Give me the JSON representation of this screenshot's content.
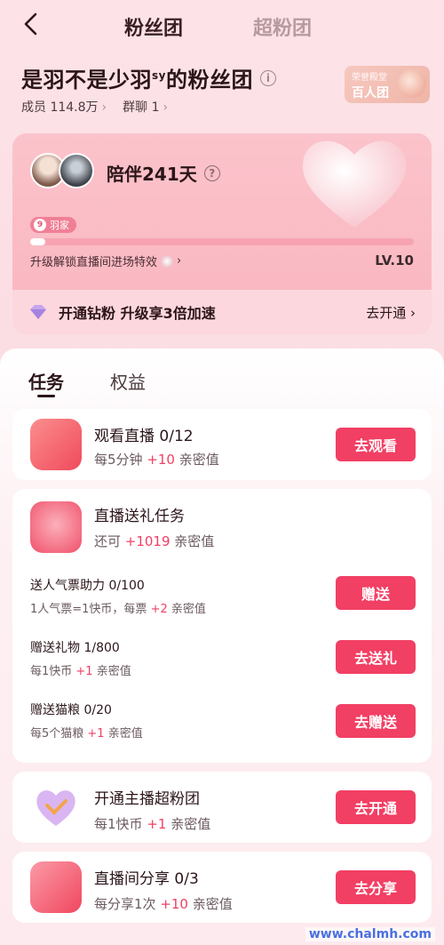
{
  "nav": {
    "tab_fans": "粉丝团",
    "tab_super": "超粉团"
  },
  "header": {
    "title": "是羽不是少羽",
    "title_sup": "sy",
    "title_suffix": "的粉丝团",
    "members": "成员 114.8万",
    "group_chat": "群聊 1"
  },
  "honor": {
    "line1": "荣誉殿堂",
    "line2": "百人团"
  },
  "card": {
    "accompany": "陪伴241天",
    "badge_level": "9",
    "badge_name": "羽家",
    "progress_fraction": 0.04,
    "unlock_text": "升级解锁直播间进场特效",
    "level": "LV.10",
    "diamond_text": "开通钻粉 升级享3倍加速",
    "diamond_action": "去开通"
  },
  "tabs": {
    "task": "任务",
    "rights": "权益"
  },
  "tasks": {
    "watch": {
      "title": "观看直播 0/12",
      "sub_pre": "每5分钟 ",
      "sub_val": "+10",
      "sub_post": " 亲密值",
      "button": "去观看"
    },
    "gift": {
      "title": "直播送礼任务",
      "sub_pre": "还可 ",
      "sub_val": "+1019",
      "sub_post": " 亲密值"
    },
    "popularity": {
      "title": "送人气票助力 0/100",
      "sub_pre": "1人气票=1快币，每票 ",
      "sub_val": "+2",
      "sub_post": " 亲密值",
      "button": "赠送"
    },
    "present": {
      "title": "赠送礼物 1/800",
      "sub_pre": "每1快币 ",
      "sub_val": "+1",
      "sub_post": " 亲密值",
      "button": "去送礼"
    },
    "catfood": {
      "title": "赠送猫粮 0/20",
      "sub_pre": "每5个猫粮 ",
      "sub_val": "+1",
      "sub_post": " 亲密值",
      "button": "去赠送"
    },
    "superfan": {
      "title": "开通主播超粉团",
      "sub_pre": "每1快币 ",
      "sub_val": "+1",
      "sub_post": " 亲密值",
      "button": "去开通"
    },
    "share": {
      "title": "直播间分享 0/3",
      "sub_pre": "每分享1次 ",
      "sub_val": "+10",
      "sub_post": " 亲密值",
      "button": "去分享"
    }
  },
  "watermark": "www.chalmh.com"
}
